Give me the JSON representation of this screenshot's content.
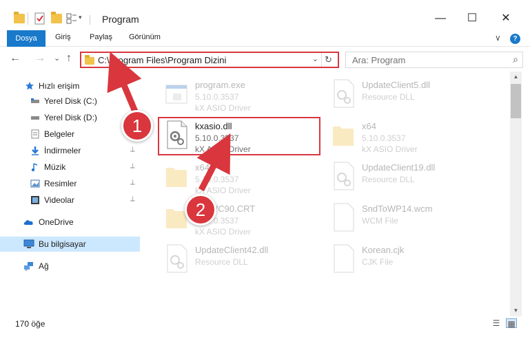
{
  "window": {
    "title": "Program",
    "controls": {
      "minimize": "—",
      "maximize": "☐",
      "close": "✕"
    }
  },
  "ribbon": {
    "tabs": [
      "Dosya",
      "Giriş",
      "Paylaş",
      "Görünüm"
    ],
    "expand_glyph": "∨",
    "help_glyph": "?"
  },
  "nav": {
    "back": "←",
    "forward": "→",
    "recent": "⌄",
    "up": "↑",
    "address": "C:\\Program Files\\Program Dizini",
    "address_dropdown": "⌄",
    "refresh": "↻",
    "search_placeholder": "Ara: Program",
    "search_icon": "⌕"
  },
  "sidebar": {
    "items": [
      {
        "label": "Hızlı erişim",
        "icon": "star-icon"
      },
      {
        "label": "Yerel Disk (C:)",
        "icon": "drive-icon"
      },
      {
        "label": "Yerel Disk (D:)",
        "icon": "drive-icon"
      },
      {
        "label": "Belgeler",
        "icon": "documents-icon"
      },
      {
        "label": "İndirmeler",
        "icon": "download-icon"
      },
      {
        "label": "Müzik",
        "icon": "music-icon"
      },
      {
        "label": "Resimler",
        "icon": "pictures-icon"
      },
      {
        "label": "Videolar",
        "icon": "video-icon"
      },
      {
        "label": "OneDrive",
        "icon": "cloud-icon"
      },
      {
        "label": "Bu bilgisayar",
        "icon": "computer-icon"
      },
      {
        "label": "Ağ",
        "icon": "network-icon"
      }
    ],
    "pin_glyph": "📌"
  },
  "files": [
    {
      "name": "program.exe",
      "line1": "5.10.0.3537",
      "line2": "kX ASIO Driver",
      "type": "exe"
    },
    {
      "name": "UpdateClient5.dll",
      "line1": "Resource DLL",
      "line2": "",
      "type": "dll"
    },
    {
      "name": "kxasio.dll",
      "line1": "5.10.0.3537",
      "line2": "kX ASIO Driver",
      "type": "dll"
    },
    {
      "name": "x64",
      "line1": "5.10.0.3537",
      "line2": "kX ASIO Driver",
      "type": "folder"
    },
    {
      "name": "x64",
      "line1": "5.10.0.3537",
      "line2": "kX ASIO Driver",
      "type": "folder"
    },
    {
      "name": "UpdateClient19.dll",
      "line1": "Resource DLL",
      "line2": "",
      "type": "dll"
    },
    {
      "name": "soft.VC90.CRT",
      "line1": "5.10.0.3537",
      "line2": "kX ASIO Driver",
      "type": "folder"
    },
    {
      "name": "SndToWP14.wcm",
      "line1": "WCM File",
      "line2": "",
      "type": "file"
    },
    {
      "name": "UpdateClient42.dll",
      "line1": "Resource DLL",
      "line2": "",
      "type": "dll"
    },
    {
      "name": "Korean.cjk",
      "line1": "CJK File",
      "line2": "",
      "type": "file"
    }
  ],
  "annotations": {
    "step1": "1",
    "step2": "2"
  },
  "status": {
    "count": "170 öğe"
  },
  "colors": {
    "accent": "#1979ca",
    "annotation_red": "#d9363e",
    "selected": "#cce8ff"
  }
}
